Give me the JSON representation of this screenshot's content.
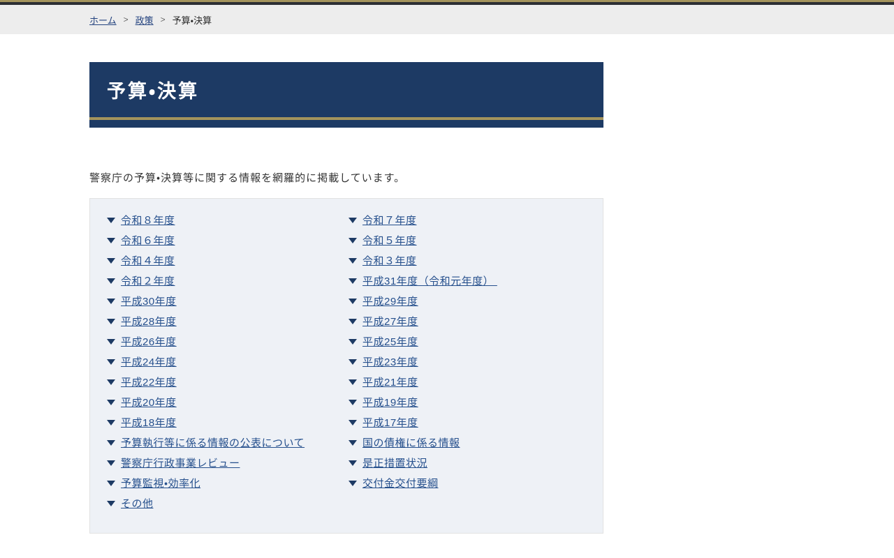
{
  "breadcrumb": {
    "separator": ">",
    "home_label": "ホーム",
    "policy_label": "政策",
    "current_label": "予算・決算"
  },
  "banner": {
    "title": "予算・決算"
  },
  "intro_text": "警察庁の予算・決算等に関する情報を網羅的に掲載しています。",
  "link_columns": {
    "left": [
      "令和８年度",
      "令和６年度",
      "令和４年度",
      "令和２年度",
      "平成30年度",
      "平成28年度",
      "平成26年度",
      "平成24年度",
      "平成22年度",
      "平成20年度",
      "平成18年度",
      "予算執行等に係る情報の公表について",
      "警察庁行政事業レビュー",
      "予算監視・効率化",
      "その他"
    ],
    "right": [
      "令和７年度",
      "令和５年度",
      "令和３年度",
      "平成31年度（令和元年度） ",
      "平成29年度",
      "平成27年度",
      "平成25年度",
      "平成23年度",
      "平成21年度",
      "平成19年度",
      "平成17年度",
      "国の債権に係る情報",
      "是正措置状況",
      "交付金交付要綱"
    ]
  },
  "colors": {
    "navy": "#1d3a64",
    "gold": "#a4945c",
    "link_blue": "#26508d",
    "panel_bg": "#eef1f6",
    "breadcrumb_bg": "#ededed"
  }
}
